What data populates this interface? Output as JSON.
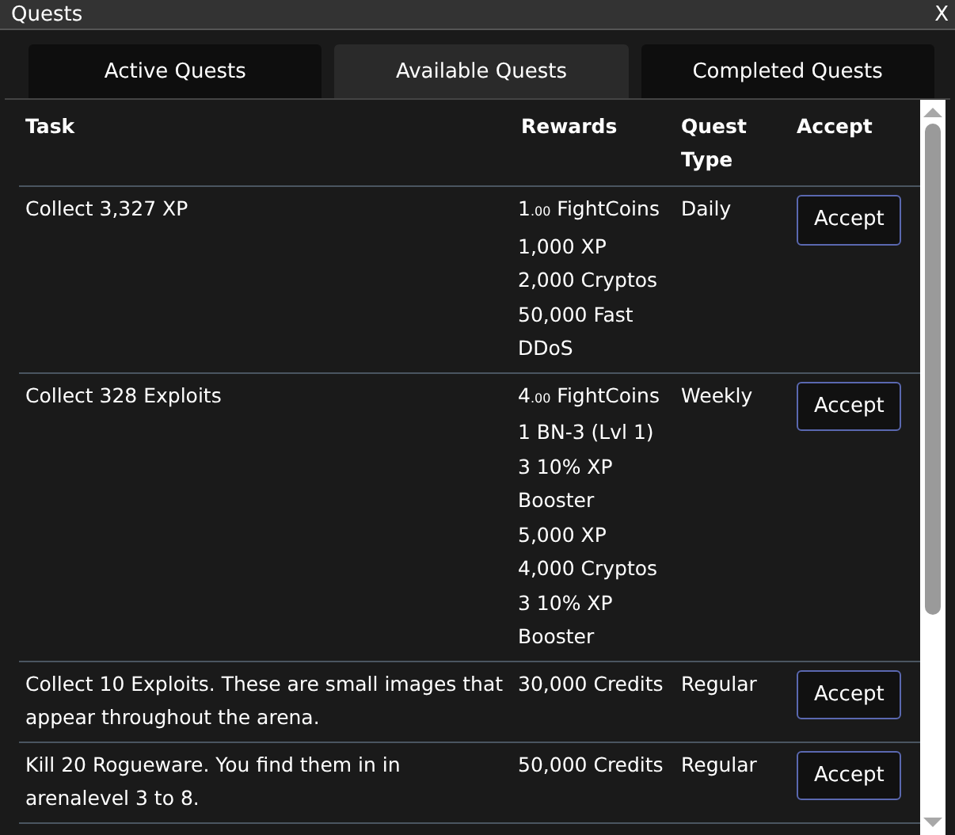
{
  "window": {
    "title": "Quests",
    "close": "X"
  },
  "tabs": [
    {
      "label": "Active Quests",
      "selected": false
    },
    {
      "label": "Available Quests",
      "selected": true
    },
    {
      "label": "Completed Quests",
      "selected": false
    }
  ],
  "table": {
    "columns": [
      "Task",
      "Rewards",
      "Quest Type",
      "Accept"
    ],
    "rows": [
      {
        "task": "Collect 3,327 XP",
        "rewards": [
          "1$_{.00}$ FightCoins",
          "1,000 XP",
          "2,000 Cryptos",
          "50,000 Fast DDoS"
        ],
        "type": "Daily",
        "action": "Accept"
      },
      {
        "task": "Collect 328 Exploits",
        "rewards": [
          "4$_{.00}$ FightCoins",
          "1 BN-3 (Lvl 1)",
          "3 10% XP Booster",
          "5,000 XP",
          "4,000 Cryptos",
          "3 10% XP Booster"
        ],
        "type": "Weekly",
        "action": "Accept"
      },
      {
        "task": "Collect 10 Exploits. These are small images that appear throughout the arena.",
        "rewards": [
          "30,000 Credits"
        ],
        "type": "Regular",
        "action": "Accept"
      },
      {
        "task": "Kill 20 Rogueware. You find them in in arenalevel 3 to 8.",
        "rewards": [
          "50,000 Credits"
        ],
        "type": "Regular",
        "action": "Accept"
      }
    ]
  }
}
